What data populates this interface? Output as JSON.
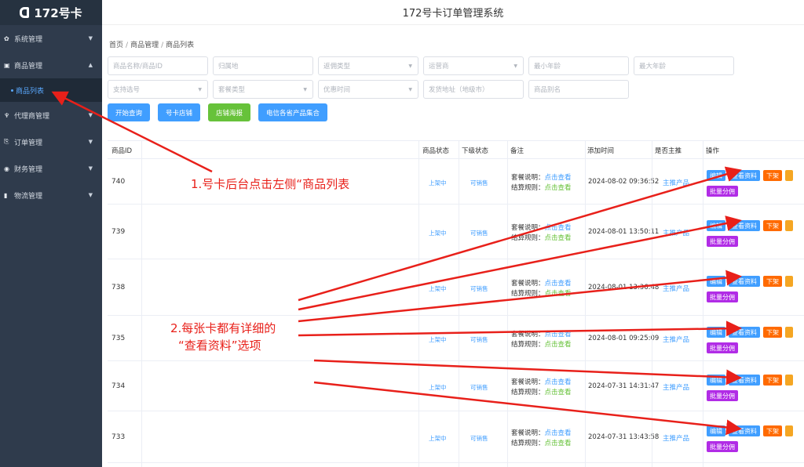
{
  "app": {
    "logo": "172号卡",
    "title": "172号卡订单管理系统"
  },
  "sidebar": {
    "items": [
      {
        "label": "系统管理",
        "icon": "gear-icon",
        "glyph": "✿",
        "caret": "▼"
      },
      {
        "label": "商品管理",
        "icon": "box-icon",
        "glyph": "▣",
        "caret": "▲"
      },
      {
        "label": "代理商管理",
        "icon": "agent-icon",
        "glyph": "♆",
        "caret": "▼"
      },
      {
        "label": "订单管理",
        "icon": "order-icon",
        "glyph": "⎘",
        "caret": "▼"
      },
      {
        "label": "财务管理",
        "icon": "finance-icon",
        "glyph": "◉",
        "caret": "▼"
      },
      {
        "label": "物流管理",
        "icon": "bookmark-icon",
        "glyph": "▮",
        "caret": "▼"
      }
    ],
    "active_sub": "商品列表"
  },
  "breadcrumb": [
    "首页",
    "商品管理",
    "商品列表"
  ],
  "filters": {
    "row1": [
      {
        "placeholder": "商品名称/商品ID",
        "select": false
      },
      {
        "placeholder": "归属地",
        "select": false
      },
      {
        "placeholder": "返佣类型",
        "select": true
      },
      {
        "placeholder": "运营商",
        "select": true
      },
      {
        "placeholder": "最小年龄",
        "select": false
      },
      {
        "placeholder": "最大年龄",
        "select": false
      }
    ],
    "row2": [
      {
        "placeholder": "支持选号",
        "select": true
      },
      {
        "placeholder": "套餐类型",
        "select": true
      },
      {
        "placeholder": "优惠时间",
        "select": true
      },
      {
        "placeholder": "发货地址（地级市）",
        "select": false
      },
      {
        "placeholder": "商品别名",
        "select": false
      }
    ],
    "buttons": [
      "开始查询",
      "号卡店铺",
      "店铺海报",
      "电信各省产品集合"
    ]
  },
  "table": {
    "headers": [
      "商品ID",
      "商品状态",
      "下级状态",
      "备注",
      "添加时间",
      "是否主推",
      "操作"
    ],
    "note_label1": "套餐说明：",
    "note_label2": "结算规则：",
    "note_link": "点击查看",
    "ops": {
      "edit": "编辑",
      "view": "查看资料",
      "down": "下架",
      "split": "批量分佣"
    },
    "rows": [
      {
        "id": "740",
        "status": "上架中",
        "sub_status": "可销售",
        "time": "2024-08-02 09:36:52",
        "main": "主推产品"
      },
      {
        "id": "739",
        "status": "上架中",
        "sub_status": "可销售",
        "time": "2024-08-01 13:50:11",
        "main": "主推产品"
      },
      {
        "id": "738",
        "status": "上架中",
        "sub_status": "可销售",
        "time": "2024-08-01 13:36:48",
        "main": "主推产品"
      },
      {
        "id": "735",
        "status": "上架中",
        "sub_status": "可销售",
        "time": "2024-08-01 09:25:09",
        "main": "主推产品"
      },
      {
        "id": "734",
        "status": "上架中",
        "sub_status": "可销售",
        "time": "2024-07-31 14:31:47",
        "main": "主推产品"
      },
      {
        "id": "733",
        "status": "上架中",
        "sub_status": "可销售",
        "time": "2024-07-31 13:43:58",
        "main": "主推产品"
      }
    ]
  },
  "annotations": {
    "step1": "1.号卡后台点击左侧“商品列表",
    "step2_line1": "2.每张卡都有详细的",
    "step2_line2": "“查看资料”选项",
    "color": "#e8201a"
  }
}
